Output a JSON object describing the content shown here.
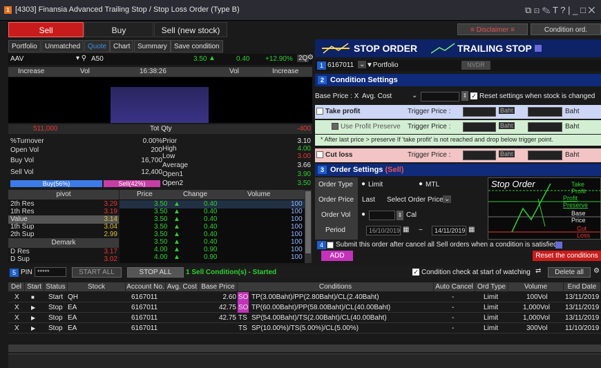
{
  "window": {
    "badge": "1",
    "title": "[4303] Finansia Advanced Trailing Stop / Stop Loss Order (Type B)",
    "controls": "⧉ ⊡ ✎ T ? | _ □ ✕"
  },
  "tabs": {
    "sell": "Sell",
    "buy": "Buy",
    "sell_new": "Sell (new stock)"
  },
  "right_buttons": {
    "disclaimer": "Disclaimer",
    "condition_ord": "Condition ord."
  },
  "subtabs": [
    "Portfolio",
    "Unmatched",
    "Quote",
    "Chart",
    "Summary",
    "Save condition"
  ],
  "quote": {
    "symbol": "AAV",
    "search": "A50",
    "price": "3.50",
    "change": "0.40",
    "pct": "+12.90%",
    "board": "2Q"
  },
  "depth_header": {
    "increase": "Increase",
    "vol": "Vol",
    "time": "16:38:26",
    "vol2": "Vol",
    "increase2": "Increase"
  },
  "tot": {
    "left": "511,000",
    "label": "Tot Qty",
    "right": "-400"
  },
  "stats": [
    {
      "k": "%Turnover",
      "v": "0.00%",
      "k2": "Prior",
      "v2": "3.10",
      "c": "w"
    },
    {
      "k": "Open Vol",
      "v": "200",
      "k2": "High",
      "v2": "4.00",
      "c": "g"
    },
    {
      "k": "Buy Vol",
      "v": "16,700",
      "k2": "Low",
      "v2": "3.00",
      "c": "r"
    },
    {
      "k": "Sell Vol",
      "v": "12,400",
      "k2": "Average",
      "v2": "3.66",
      "c": "w"
    },
    {
      "k": "",
      "v": "",
      "k2": "Open1",
      "v2": "3.90",
      "c": "g"
    },
    {
      "k": "",
      "v": "",
      "k2": "Open2",
      "v2": "3.50",
      "c": "g"
    }
  ],
  "buysell": {
    "buy": "Buy(56%)",
    "sell": "Sell(42%)"
  },
  "pivot": {
    "header": "pivot",
    "demark": "Demark",
    "rows": [
      {
        "k": "2th Res",
        "v": "3.29",
        "c": "r"
      },
      {
        "k": "1th Res",
        "v": "3.19",
        "c": "r"
      },
      {
        "k": "Value",
        "v": "3.14",
        "c": "y"
      },
      {
        "k": "1th Sup",
        "v": "3.04",
        "c": "y"
      },
      {
        "k": "2th Sup",
        "v": "2.99",
        "c": "y"
      }
    ],
    "demark_rows": [
      {
        "k": "D Res",
        "v": "3.17",
        "c": "r"
      },
      {
        "k": "D Sup",
        "v": "3.02",
        "c": "r"
      }
    ]
  },
  "ticks": {
    "headers": [
      "Price",
      "Change",
      "Volume"
    ],
    "rows": [
      {
        "p": "3.50",
        "c": "0.40",
        "v": "100"
      },
      {
        "p": "3.50",
        "c": "0.40",
        "v": "100"
      },
      {
        "p": "3.50",
        "c": "0.40",
        "v": "100"
      },
      {
        "p": "3.50",
        "c": "0.40",
        "v": "100"
      },
      {
        "p": "3.50",
        "c": "0.40",
        "v": "100"
      },
      {
        "p": "3.50",
        "c": "0.40",
        "v": "100"
      },
      {
        "p": "4.00",
        "c": "0.90",
        "v": "100"
      },
      {
        "p": "4.00",
        "c": "0.90",
        "v": "100"
      }
    ]
  },
  "order": {
    "stop_title": "STOP ORDER",
    "trailing_title": "TRAILING STOP",
    "account": "6167011",
    "portfolio": "▼Portfolio",
    "nvdr": "NVDR",
    "cond_head": "Condition Settings",
    "base_price": "Base Price : X",
    "avg_cost": "Avg. Cost",
    "reset_label": "Reset settings when stock is changed",
    "take_profit": "Take profit",
    "trigger": "Trigger Price :",
    "baht": "Baht",
    "use_profit": "Use Profit Preserve",
    "note": "* After last price > preserve If 'take profit' is not reached and drop below trigger point.",
    "cut_loss": "Cut loss",
    "order_head": "Order Settings",
    "order_head_sell": "(Sell)",
    "order_type": "Order Type",
    "limit": "Limit",
    "mtl": "MTL",
    "order_price": "Order Price",
    "last": "Last",
    "select_order_price": "Select Order Price",
    "order_vol": "Order Vol",
    "cal": "Cal",
    "period": "Period",
    "date_from": "16/10/2019",
    "tilde": "~",
    "date_to": "14/11/2019",
    "submit": "Submit this order after cancel all Sell orders when a condition is satisfied",
    "add": "ADD",
    "reset_cond": "Reset the conditions",
    "diag_title": "Stop Order",
    "diag_tp": "Take Profit",
    "diag_pp": "Profit Preserve",
    "diag_bp": "Base Price",
    "diag_cl": "Cut Loss",
    "n1": "1",
    "n2": "2",
    "n3": "3",
    "n4": "4"
  },
  "bottom_bar": {
    "n5": "5",
    "pin": "PIN",
    "pin_val": "*****",
    "start_all": "START ALL",
    "stop_all": "STOP ALL",
    "status": "1 Sell Condition(s) - Started",
    "cond_check": "Condition check at start of watching",
    "delete_all": "Delete all"
  },
  "table": {
    "headers": [
      "Del",
      "Start",
      "Status",
      "Stock",
      "Account No.",
      "Avg. Cost",
      "Base Price",
      "Conditions",
      "Auto Cancel",
      "Ord Type",
      "Volume",
      "End Date"
    ],
    "rows": [
      {
        "del": "X",
        "start": "■",
        "status": "Start",
        "stock": "QH",
        "acct": "6167011",
        "avg": "",
        "base": "2.60",
        "type": "SO",
        "cond": "TP(3.00Baht)/PP(2.80Baht)/CL(2.40Baht)",
        "auto": "-",
        "ord": "Limit",
        "vol": "100Vol",
        "end": "13/11/2019"
      },
      {
        "del": "X",
        "start": "▶",
        "status": "Stop",
        "stock": "EA",
        "acct": "6167011",
        "avg": "",
        "base": "42.75",
        "type": "SO",
        "cond": "TP(60.00Baht)/PP(58.00Baht)/CL(40.00Baht)",
        "auto": "-",
        "ord": "Limit",
        "vol": "1,000Vol",
        "end": "13/11/2019"
      },
      {
        "del": "X",
        "start": "▶",
        "status": "Stop",
        "stock": "EA",
        "acct": "6167011",
        "avg": "",
        "base": "42.75",
        "type": "TS",
        "cond": "SP(54.00Baht)/TS(2.00Baht)/CL(40.00Baht)",
        "auto": "-",
        "ord": "Limit",
        "vol": "1,000Vol",
        "end": "13/11/2019"
      },
      {
        "del": "X",
        "start": "▶",
        "status": "Stop",
        "stock": "EA",
        "acct": "6167011",
        "avg": "",
        "base": "",
        "type": "TS",
        "cond": "SP(10.00%)/TS(5.00%)/CL(5.00%)",
        "auto": "-",
        "ord": "Limit",
        "vol": "300Vol",
        "end": "11/10/2019"
      }
    ]
  }
}
